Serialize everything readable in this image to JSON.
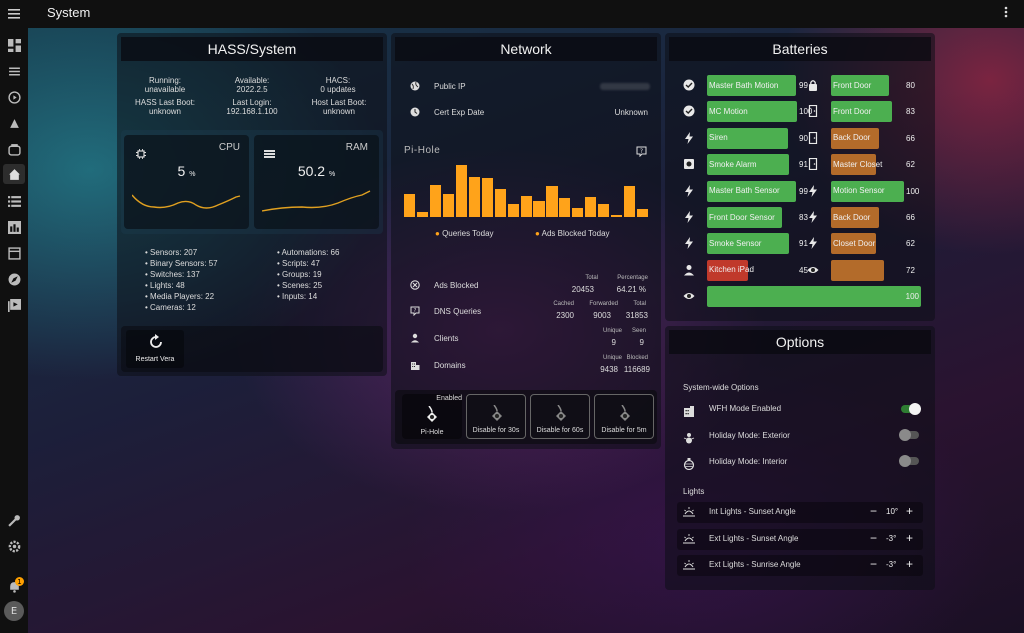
{
  "app": {
    "title": "System"
  },
  "sidebar": {
    "icons": [
      "dashboard-icon",
      "energy-icon",
      "media-icon",
      "map-icon",
      "hacs-icon",
      "home-icon",
      "list-icon",
      "history-icon",
      "logbook-icon",
      "explore-icon",
      "media-browser-icon"
    ],
    "bottom_icons": [
      "developer-tools-icon",
      "settings-icon",
      "notifications-icon"
    ],
    "notification_count": "1",
    "avatar_initial": "E"
  },
  "hass": {
    "header": "HASS/System",
    "running_label": "Running:",
    "running_value": "unavailable",
    "available_label": "Available:",
    "available_value": "2022.2.5",
    "hacs_label": "HACS:",
    "hacs_value": "0 updates",
    "last_boot_label": "HASS Last Boot:",
    "last_boot_value": "unknown",
    "last_login_label": "Last Login:",
    "last_login_value": "192.168.1.100",
    "host_boot_label": "Host Last Boot:",
    "host_boot_value": "unknown",
    "cpu": {
      "label": "CPU",
      "value": "5",
      "unit": "%"
    },
    "ram": {
      "label": "RAM",
      "value": "50.2",
      "unit": "%"
    },
    "stats_left": [
      "Sensors: 207",
      "Binary Sensors: 57",
      "Switches: 137",
      "Lights: 48",
      "Media Players: 22",
      "Cameras: 12"
    ],
    "stats_right": [
      "Automations: 66",
      "Scripts: 47",
      "Groups: 19",
      "Scenes: 25",
      "Inputs: 14"
    ],
    "restart_label": "Restart Vera"
  },
  "network": {
    "header": "Network",
    "public_ip_label": "Public IP",
    "public_ip_value": "",
    "cert_label": "Cert Exp Date",
    "cert_value": "Unknown",
    "pihole_title": "Pi-Hole",
    "legend": [
      "Queries Today",
      "Ads Blocked Today"
    ],
    "ads_blocked": {
      "label": "Ads Blocked",
      "h1": "Total",
      "v1": "20453",
      "h2": "Percentage",
      "v2": "64.21 %"
    },
    "dns_queries": {
      "label": "DNS Queries",
      "h1": "Cached",
      "v1": "2300",
      "h2": "Forwarded",
      "v2": "9003",
      "h3": "Total",
      "v3": "31853"
    },
    "clients": {
      "label": "Clients",
      "h1": "Unique",
      "v1": "9",
      "h2": "Seen",
      "v2": "9"
    },
    "domains": {
      "label": "Domains",
      "h1": "Unique",
      "v1": "9438",
      "h2": "Blocked",
      "v2": "116689"
    },
    "enabled_label": "Enabled",
    "buttons": [
      "Pi-Hole",
      "Disable for 30s",
      "Disable for 60s",
      "Disable for 5m"
    ]
  },
  "pihole_chart": {
    "values": [
      34,
      8,
      48,
      34,
      78,
      60,
      58,
      42,
      20,
      32,
      24,
      46,
      28,
      14,
      30,
      20,
      2,
      46,
      12
    ],
    "colors": {
      "queries": "#ffa31a",
      "ads": "#ffa31a"
    }
  },
  "batteries": {
    "header": "Batteries",
    "left": [
      {
        "name": "Master Bath Motion",
        "pct": "99",
        "level": 0.99,
        "color": "#4caf50",
        "icon": "check-circle-icon"
      },
      {
        "name": "MC Motion",
        "pct": "100",
        "level": 1.0,
        "color": "#4caf50",
        "icon": "check-circle-icon"
      },
      {
        "name": "Siren",
        "pct": "90",
        "level": 0.9,
        "color": "#4caf50",
        "icon": "lightning-icon"
      },
      {
        "name": "Smoke Alarm",
        "pct": "91",
        "level": 0.91,
        "color": "#4caf50",
        "icon": "smoke-detector-icon"
      },
      {
        "name": "Master Bath Sensor",
        "pct": "99",
        "level": 0.99,
        "color": "#4caf50",
        "icon": "lightning-icon"
      },
      {
        "name": "Front Door Sensor",
        "pct": "83",
        "level": 0.83,
        "color": "#4caf50",
        "icon": "lightning-icon"
      },
      {
        "name": "Smoke Sensor",
        "pct": "91",
        "level": 0.91,
        "color": "#4caf50",
        "icon": "lightning-icon"
      },
      {
        "name": "Kitchen iPad",
        "pct": "45",
        "level": 0.45,
        "color": "#c0392b",
        "icon": "person-icon"
      },
      {
        "name": "",
        "pct": "100",
        "level": 1.0,
        "color": "#4caf50",
        "icon": "eye-icon"
      }
    ],
    "right": [
      {
        "name": "Front Door",
        "pct": "80",
        "level": 0.8,
        "color": "#4caf50",
        "icon": "lock-icon"
      },
      {
        "name": "Front Door",
        "pct": "83",
        "level": 0.83,
        "color": "#4caf50",
        "icon": "door-icon"
      },
      {
        "name": "Back Door",
        "pct": "66",
        "level": 0.66,
        "color": "#b36b2a",
        "icon": "door-icon"
      },
      {
        "name": "Master Closet",
        "pct": "62",
        "level": 0.62,
        "color": "#b36b2a",
        "icon": "door-icon"
      },
      {
        "name": "Motion Sensor",
        "pct": "100",
        "level": 1.0,
        "color": "#4caf50",
        "icon": "lightning-icon"
      },
      {
        "name": "Back Door",
        "pct": "66",
        "level": 0.66,
        "color": "#b36b2a",
        "icon": "lightning-icon"
      },
      {
        "name": "Closet Door",
        "pct": "62",
        "level": 0.62,
        "color": "#b36b2a",
        "icon": "lightning-icon"
      },
      {
        "name": "",
        "pct": "72",
        "level": 0.72,
        "color": "#b36b2a",
        "icon": "eye-icon"
      }
    ]
  },
  "options": {
    "header": "Options",
    "system_section": "System-wide Options",
    "toggles": [
      {
        "label": "WFH Mode Enabled",
        "on": true,
        "icon": "office-building-icon"
      },
      {
        "label": "Holiday Mode: Exterior",
        "on": false,
        "icon": "snowman-icon"
      },
      {
        "label": "Holiday Mode: Interior",
        "on": false,
        "icon": "ornament-icon"
      }
    ],
    "lights_section": "Lights",
    "angles": [
      {
        "label": "Int Lights - Sunset Angle",
        "value": "10°",
        "icon": "sunset-icon"
      },
      {
        "label": "Ext Lights - Sunset Angle",
        "value": "-3°",
        "icon": "sunset-icon"
      },
      {
        "label": "Ext Lights - Sunrise Angle",
        "value": "-3°",
        "icon": "sunrise-icon"
      }
    ],
    "minus": "−",
    "plus": "+"
  }
}
